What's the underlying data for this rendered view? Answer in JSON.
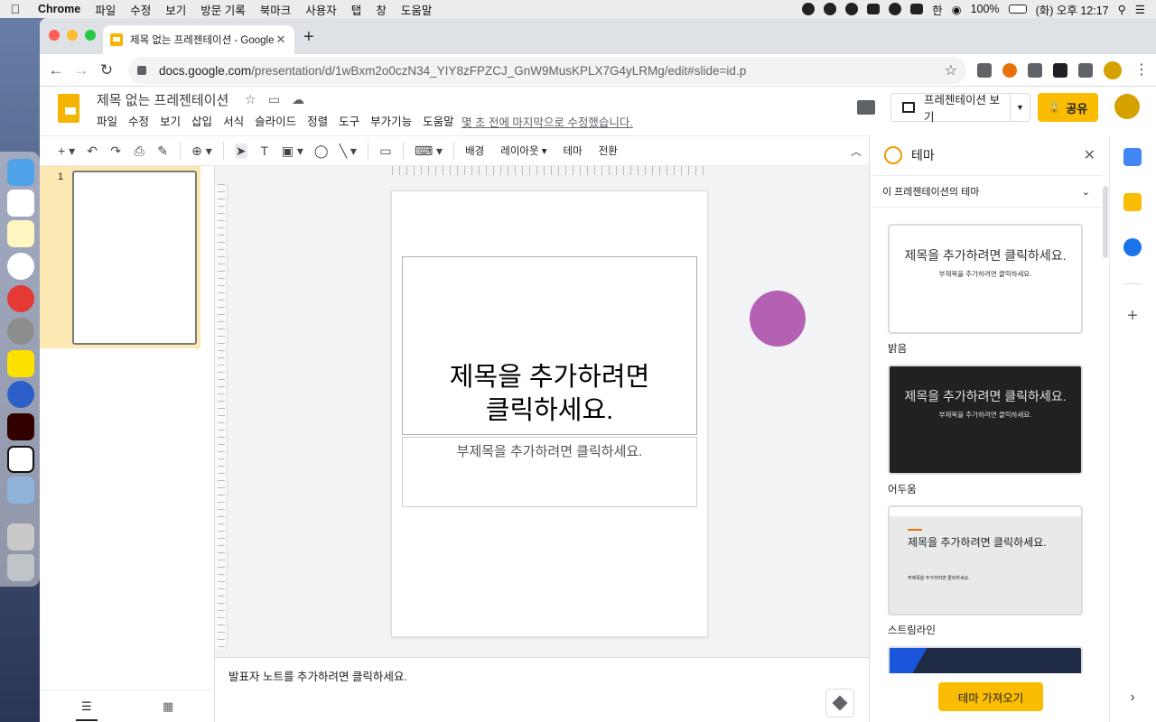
{
  "menubar": {
    "app": "Chrome",
    "items": [
      "파일",
      "수정",
      "보기",
      "방문 기록",
      "북마크",
      "사용자",
      "탭",
      "창",
      "도움말"
    ],
    "battery": "100%",
    "ime": "한",
    "clock": "(화) 오후 12:17"
  },
  "browser": {
    "tab_title": "제목 없는 프레젠테이션 - Google S",
    "url_domain": "docs.google.com",
    "url_path": "/presentation/d/1wBxm2o0czN34_YIY8zFPZCJ_GnW9MusKPLX7G4yLRMg/edit#slide=id.p"
  },
  "docs": {
    "title": "제목 없는 프레젠테이션",
    "menu": [
      "파일",
      "수정",
      "보기",
      "삽입",
      "서식",
      "슬라이드",
      "정렬",
      "도구",
      "부가기능",
      "도움말"
    ],
    "last_edit": "몇 초 전에 마지막으로 수정했습니다.",
    "present_label": "프레젠테이션 보기",
    "share_label": "공유"
  },
  "toolbar": {
    "background": "배경",
    "layout": "레이아웃",
    "theme": "테마",
    "transition": "전환"
  },
  "filmstrip": {
    "slide_number": "1"
  },
  "slide": {
    "title": "제목을 추가하려면 클릭하세요.",
    "subtitle": "부제목을 추가하려면 클릭하세요."
  },
  "notes": {
    "placeholder": "발표자 노트를 추가하려면 클릭하세요."
  },
  "theme_panel": {
    "title": "테마",
    "section": "이 프레젠테이션의 테마",
    "themes": [
      {
        "name": "밝음",
        "title": "제목을 추가하려면 클릭하세요.",
        "subtitle": "부제목을 추가하려면 클릭하세요.",
        "bg": "#ffffff",
        "fg": "#333333"
      },
      {
        "name": "어두움",
        "title": "제목을 추가하려면 클릭하세요.",
        "subtitle": "부제목을 추가하려면 클릭하세요.",
        "bg": "#212121",
        "fg": "#e0e0e0"
      },
      {
        "name": "스트림라인",
        "title": "제목을 추가하려면 클릭하세요.",
        "subtitle": "부제목을 추가하려면 클릭하세요.",
        "bg": "#e8eaea",
        "fg": "#202124"
      }
    ],
    "import_label": "테마 가져오기"
  },
  "colors": {
    "accent": "#fbbc04",
    "slides_brand": "#f4b400",
    "selected_thumb": "#fce8b2",
    "cursor_circle": "#b561b3"
  }
}
